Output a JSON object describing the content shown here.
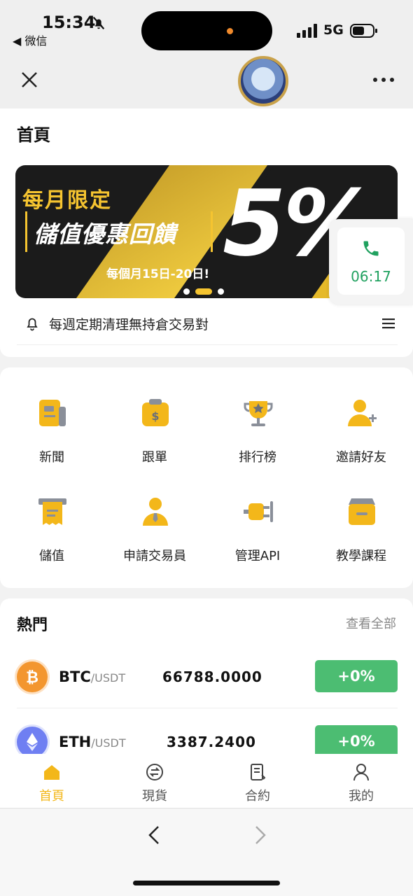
{
  "status_bar": {
    "time": "15:34",
    "back_app": "◀ 微信",
    "network": "5G"
  },
  "page_title": "首頁",
  "banner": {
    "line1": "每月限定",
    "line2": "儲值優惠回饋",
    "line3": "每個月15日-20日!",
    "big": "5%"
  },
  "call_widget": {
    "time": "06:17"
  },
  "notice": {
    "text": "每週定期清理無持倉交易對"
  },
  "grid": [
    {
      "label": "新聞",
      "icon": "news-icon"
    },
    {
      "label": "跟單",
      "icon": "copy-trade-icon"
    },
    {
      "label": "排行榜",
      "icon": "trophy-icon"
    },
    {
      "label": "邀請好友",
      "icon": "invite-icon"
    },
    {
      "label": "儲值",
      "icon": "deposit-icon"
    },
    {
      "label": "申請交易員",
      "icon": "trader-icon"
    },
    {
      "label": "管理API",
      "icon": "plug-icon"
    },
    {
      "label": "教學課程",
      "icon": "course-icon"
    }
  ],
  "hot": {
    "title": "熱門",
    "more": "查看全部",
    "rows": [
      {
        "base": "BTC",
        "quote": "/USDT",
        "price": "66788.0000",
        "change": "+0%"
      },
      {
        "base": "ETH",
        "quote": "/USDT",
        "price": "3387.2400",
        "change": "+0%"
      }
    ]
  },
  "tabs": [
    {
      "label": "首頁",
      "icon": "home-icon"
    },
    {
      "label": "現貨",
      "icon": "spot-icon"
    },
    {
      "label": "合約",
      "icon": "contract-icon"
    },
    {
      "label": "我的",
      "icon": "profile-icon"
    }
  ],
  "colors": {
    "accent": "#f3b71a",
    "positive": "#4cbd72",
    "call": "#20a15f"
  }
}
